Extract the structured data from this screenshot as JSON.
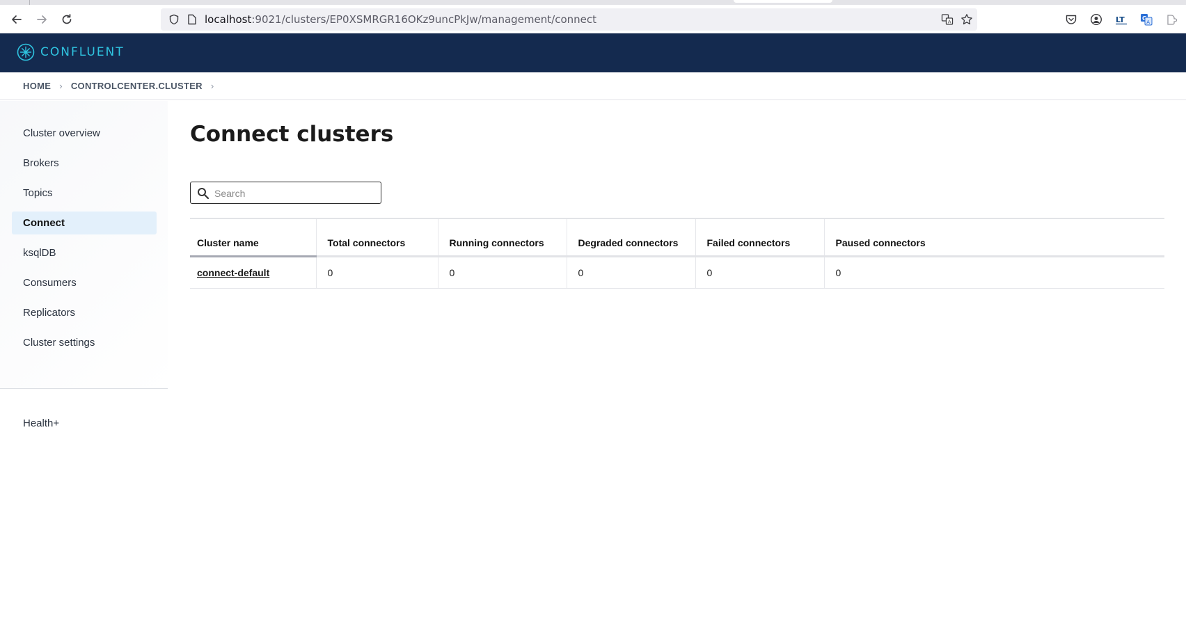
{
  "browser": {
    "url_host": "localhost",
    "url_rest": ":9021/clusters/EP0XSMRGR16OKz9uncPkJw/management/connect"
  },
  "brand": {
    "name": "CONFLUENT",
    "accent": "#2fc4e0",
    "header_bg": "#142a4f"
  },
  "breadcrumb": {
    "items": [
      "HOME",
      "CONTROLCENTER.CLUSTER"
    ]
  },
  "sidebar": {
    "items": [
      {
        "label": "Cluster overview",
        "active": false
      },
      {
        "label": "Brokers",
        "active": false
      },
      {
        "label": "Topics",
        "active": false
      },
      {
        "label": "Connect",
        "active": true
      },
      {
        "label": "ksqlDB",
        "active": false
      },
      {
        "label": "Consumers",
        "active": false
      },
      {
        "label": "Replicators",
        "active": false
      },
      {
        "label": "Cluster settings",
        "active": false
      }
    ],
    "footer_item": "Health+"
  },
  "main": {
    "title": "Connect clusters",
    "search": {
      "placeholder": "Search",
      "value": ""
    },
    "table": {
      "columns": [
        "Cluster name",
        "Total connectors",
        "Running connectors",
        "Degraded connectors",
        "Failed connectors",
        "Paused connectors"
      ],
      "rows": [
        {
          "name": "connect-default",
          "total": "0",
          "running": "0",
          "degraded": "0",
          "failed": "0",
          "paused": "0"
        }
      ]
    }
  }
}
